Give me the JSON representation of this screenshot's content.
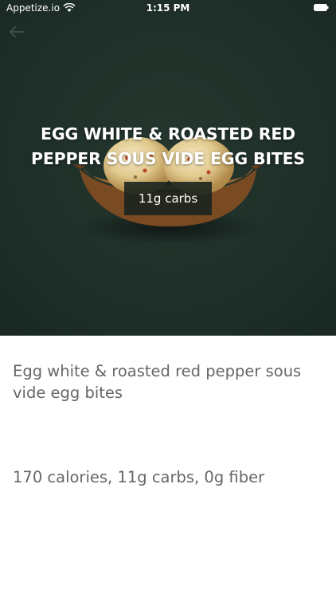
{
  "status_bar": {
    "carrier": "Appetize.io",
    "time": "1:15 PM",
    "wifi_icon": "wifi-icon",
    "battery_icon": "battery-icon"
  },
  "navigation": {
    "back_icon": "back-arrow-icon"
  },
  "hero": {
    "title": "EGG WHITE & ROASTED RED PEPPER SOUS VIDE EGG BITES",
    "badge": "11g carbs",
    "background_color": "#1d2e29"
  },
  "item": {
    "description": "Egg white & roasted red pepper sous vide egg bites",
    "nutrition": "170 calories, 11g carbs, 0g fiber"
  },
  "colors": {
    "hero_background": "#1d2e29",
    "body_text": "#666666",
    "badge_background": "#18221e"
  }
}
